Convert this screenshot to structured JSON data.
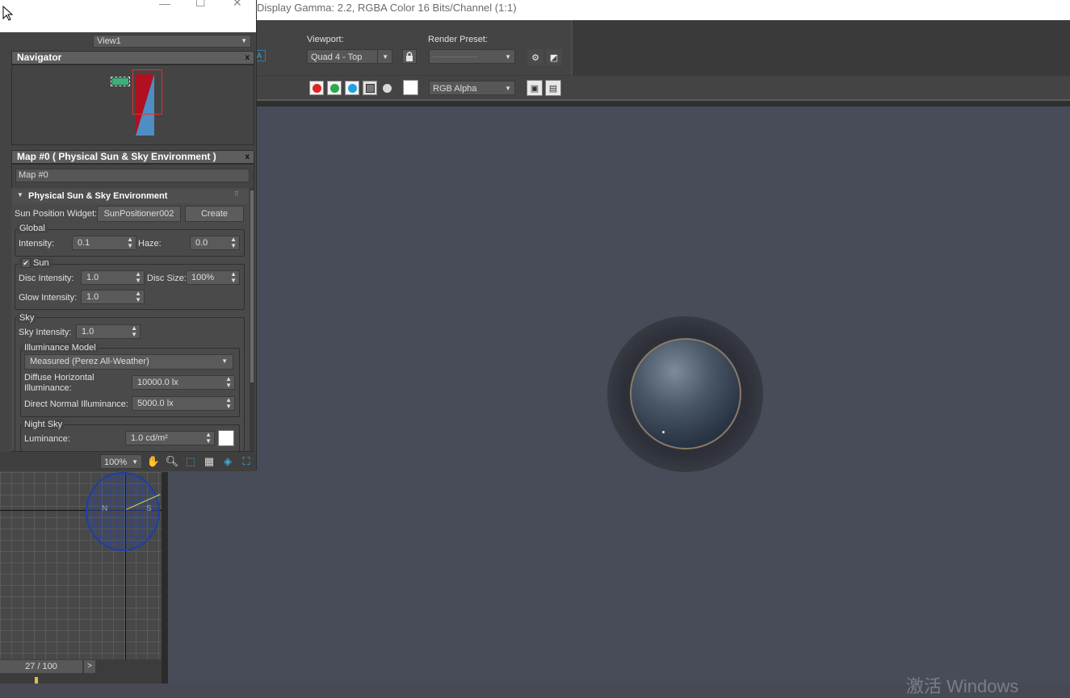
{
  "render_frame": {
    "title": "Display Gamma: 2.2, RGBA Color 16 Bits/Channel (1:1)",
    "viewport_label": "Viewport:",
    "viewport_value": "Quad 4 - Top",
    "render_preset_label": "Render Preset:",
    "render_preset_value": "----------------------------",
    "channel_value": "RGB Alpha",
    "watermark": "激活 Windows"
  },
  "slate": {
    "view_tab": "View1",
    "navigator_title": "Navigator",
    "map_panel_title": "Map #0  ( Physical Sun & Sky Environment )",
    "map_name": "Map #0",
    "rollout_title": "Physical Sun & Sky Environment",
    "sun_widget_label": "Sun Position Widget:",
    "sun_widget_value": "SunPositioner002",
    "create_label": "Create",
    "global": {
      "title": "Global",
      "intensity_label": "Intensity:",
      "intensity_value": "0.1",
      "haze_label": "Haze:",
      "haze_value": "0.0"
    },
    "sun": {
      "title": "Sun",
      "enabled": true,
      "disc_intensity_label": "Disc Intensity:",
      "disc_intensity_value": "1.0",
      "disc_size_label": "Disc Size:",
      "disc_size_value": "100%",
      "glow_intensity_label": "Glow Intensity:",
      "glow_intensity_value": "1.0"
    },
    "sky": {
      "title": "Sky",
      "sky_intensity_label": "Sky Intensity:",
      "sky_intensity_value": "1.0",
      "illuminance_title": "Illuminance Model",
      "illuminance_model": "Measured (Perez All-Weather)",
      "diffuse_label_1": "Diffuse Horizontal",
      "diffuse_label_2": "Illuminance:",
      "diffuse_value": "10000.0 lx",
      "direct_label": "Direct Normal Illuminance:",
      "direct_value": "5000.0 lx"
    },
    "night_sky": {
      "title": "Night Sky",
      "luminance_label": "Luminance:",
      "luminance_value": "1.0 cd/m²"
    },
    "zoom_value": "100%"
  },
  "viewport": {
    "compass_n": "N",
    "compass_s": "S",
    "time_slider": "27 / 100",
    "time_next": ">"
  },
  "colors": {
    "red": "#e02424",
    "green": "#2da84a",
    "blue": "#1fa3e0",
    "accent_active": "#2f8f6e"
  }
}
